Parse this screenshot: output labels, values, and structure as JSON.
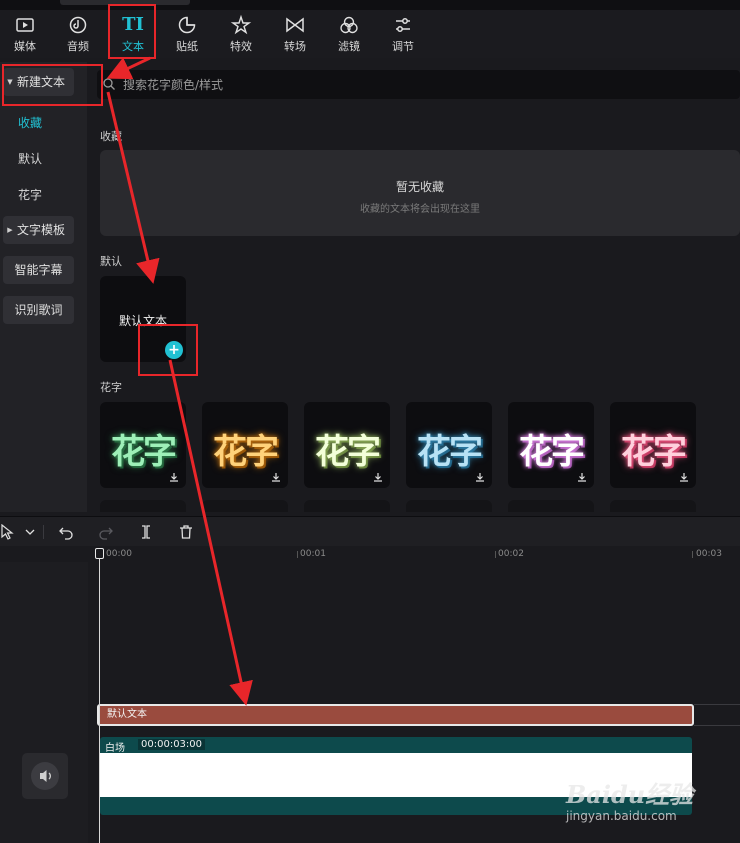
{
  "toolbar": {
    "tabs": [
      {
        "label": "媒体",
        "icon": "media-icon"
      },
      {
        "label": "音频",
        "icon": "audio-icon"
      },
      {
        "label": "文本",
        "icon": "text-icon",
        "active": true
      },
      {
        "label": "贴纸",
        "icon": "sticker-icon"
      },
      {
        "label": "特效",
        "icon": "effects-icon"
      },
      {
        "label": "转场",
        "icon": "transition-icon"
      },
      {
        "label": "滤镜",
        "icon": "filter-icon"
      },
      {
        "label": "调节",
        "icon": "adjust-icon"
      }
    ],
    "text_tab_glyph": "TI"
  },
  "sidebar": {
    "new_text": "新建文本",
    "items": [
      {
        "label": "收藏",
        "active": true
      },
      {
        "label": "默认"
      },
      {
        "label": "花字"
      }
    ],
    "text_template": "文字模板",
    "smart_subtitle": "智能字幕",
    "recognize_lyrics": "识别歌词"
  },
  "search": {
    "placeholder": "搜索花字颜色/样式"
  },
  "sections": {
    "favorites_title": "收藏",
    "favorites_empty": "暂无收藏",
    "favorites_empty_hint": "收藏的文本将会出现在这里",
    "default_title": "默认",
    "default_card_text": "默认文本",
    "flower_title": "花字"
  },
  "flower_presets": [
    {
      "glyph": "花字",
      "color": "#9df0b8",
      "glow": "#2e7a4a"
    },
    {
      "glyph": "花字",
      "color": "#ffd27a",
      "glow": "#b36a10"
    },
    {
      "glyph": "花字",
      "color": "#f3ffd9",
      "glow": "#8aa85a"
    },
    {
      "glyph": "花字",
      "color": "#b8e2f5",
      "glow": "#2f7ea6"
    },
    {
      "glyph": "花字",
      "color": "#ffffff",
      "glow": "#d07ad8"
    },
    {
      "glyph": "花字",
      "color": "#ffd0dc",
      "glow": "#e0507a"
    }
  ],
  "timeline": {
    "ticks": [
      "00:00",
      "00:01",
      "00:02",
      "00:03"
    ],
    "text_clip_label": "默认文本",
    "video_clip_name": "白场",
    "video_clip_duration": "00:00:03:00"
  },
  "watermark": {
    "top": "Baidu经验",
    "bottom": "jingyan.baidu.com"
  },
  "colors": {
    "accent": "#21c1d3",
    "annotation": "#e8262a",
    "text_clip": "#9a4b3e",
    "video_clip": "#0d4a4c"
  }
}
